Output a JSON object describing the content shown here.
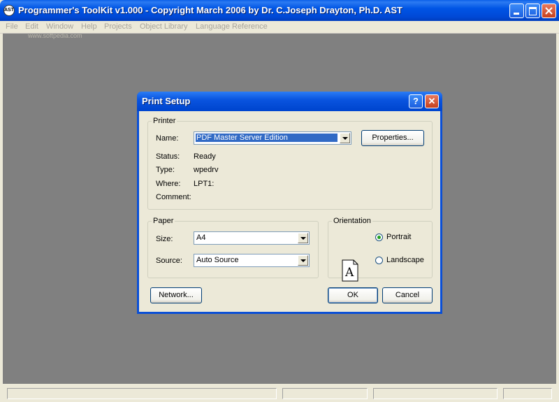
{
  "window": {
    "title": "Programmer's ToolKit v1.000 - Copyright March 2006 by Dr. C.Joseph Drayton, Ph.D. AST",
    "app_icon": "AST"
  },
  "watermark": "www.softpedia.com",
  "menu": [
    "File",
    "Edit",
    "Window",
    "Help",
    "Projects",
    "Object Library",
    "Language Reference"
  ],
  "dialog": {
    "title": "Print Setup",
    "help_glyph": "?",
    "close_glyph": "✕",
    "printer": {
      "group_label": "Printer",
      "name_label": "Name:",
      "name_value": "PDF Master Server Edition",
      "properties_button": "Properties...",
      "status_label": "Status:",
      "status_value": "Ready",
      "type_label": "Type:",
      "type_value": "wpedrv",
      "where_label": "Where:",
      "where_value": "LPT1:",
      "comment_label": "Comment:",
      "comment_value": ""
    },
    "paper": {
      "group_label": "Paper",
      "size_label": "Size:",
      "size_value": "A4",
      "source_label": "Source:",
      "source_value": "Auto Source"
    },
    "orientation": {
      "group_label": "Orientation",
      "icon_letter": "A",
      "portrait_label": "Portrait",
      "landscape_label": "Landscape",
      "selected": "Portrait"
    },
    "buttons": {
      "network": "Network...",
      "ok": "OK",
      "cancel": "Cancel"
    }
  },
  "colors": {
    "titlebar": "#0055E5",
    "mdi_background": "#808080",
    "selection": "#316AC5"
  }
}
